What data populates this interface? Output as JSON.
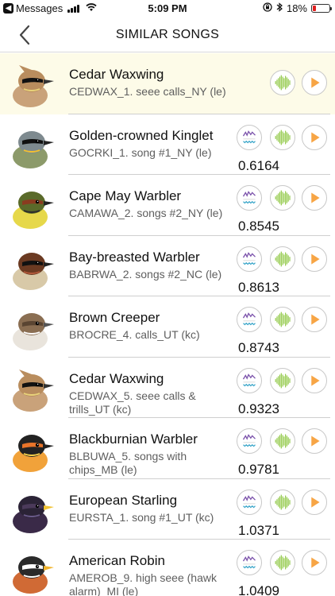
{
  "status_bar": {
    "carrier": "Messages",
    "time": "5:09 PM",
    "battery": "18%",
    "battery_level": 0.18
  },
  "nav": {
    "title": "SIMILAR SONGS"
  },
  "songs": [
    {
      "name": "Cedar Waxwing",
      "file": "CEDWAX_1. seee calls_NY (le)",
      "score": ""
    },
    {
      "name": "Golden-crowned Kinglet",
      "file": "GOCRKI_1. song #1_NY (le)",
      "score": "0.6164"
    },
    {
      "name": "Cape May Warbler",
      "file": "CAMAWA_2. songs #2_NY (le)",
      "score": "0.8545"
    },
    {
      "name": "Bay-breasted Warbler",
      "file": "BABRWA_2. songs #2_NC (le)",
      "score": "0.8613"
    },
    {
      "name": "Brown Creeper",
      "file": "BROCRE_4. calls_UT (kc)",
      "score": "0.8743"
    },
    {
      "name": "Cedar Waxwing",
      "file": "CEDWAX_5. seee calls & trills_UT (kc)",
      "score": "0.9323"
    },
    {
      "name": "Blackburnian Warbler",
      "file": "BLBUWA_5. songs with chips_MB (le)",
      "score": "0.9781"
    },
    {
      "name": "European Starling",
      "file": "EURSTA_1. song #1_UT (kc)",
      "score": "1.0371"
    },
    {
      "name": "American Robin",
      "file": "AMEROB_9. high seee (hawk alarm)_MI (le)",
      "score": "1.0409"
    }
  ],
  "icons": {
    "spectrogram": "spectrogram-icon",
    "waveform": "waveform-icon",
    "play": "play-icon"
  },
  "colors": {
    "waveform_green": "#8cc63f",
    "play_orange": "#f7a545",
    "spectro_purple": "#7b52ab",
    "spectro_blue": "#3aa6c9",
    "highlight_row": "#fdfbe8"
  }
}
